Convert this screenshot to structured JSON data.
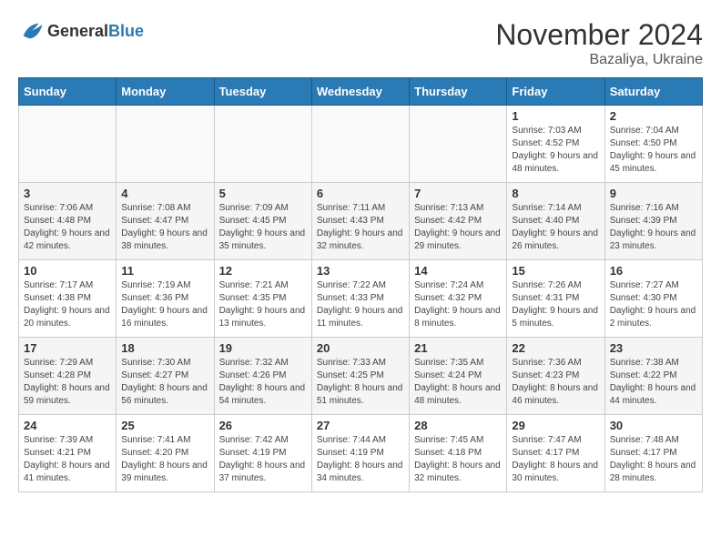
{
  "logo": {
    "general": "General",
    "blue": "Blue"
  },
  "title": {
    "month": "November 2024",
    "location": "Bazaliya, Ukraine"
  },
  "weekdays": [
    "Sunday",
    "Monday",
    "Tuesday",
    "Wednesday",
    "Thursday",
    "Friday",
    "Saturday"
  ],
  "weeks": [
    [
      {
        "day": "",
        "info": ""
      },
      {
        "day": "",
        "info": ""
      },
      {
        "day": "",
        "info": ""
      },
      {
        "day": "",
        "info": ""
      },
      {
        "day": "",
        "info": ""
      },
      {
        "day": "1",
        "info": "Sunrise: 7:03 AM\nSunset: 4:52 PM\nDaylight: 9 hours and 48 minutes."
      },
      {
        "day": "2",
        "info": "Sunrise: 7:04 AM\nSunset: 4:50 PM\nDaylight: 9 hours and 45 minutes."
      }
    ],
    [
      {
        "day": "3",
        "info": "Sunrise: 7:06 AM\nSunset: 4:48 PM\nDaylight: 9 hours and 42 minutes."
      },
      {
        "day": "4",
        "info": "Sunrise: 7:08 AM\nSunset: 4:47 PM\nDaylight: 9 hours and 38 minutes."
      },
      {
        "day": "5",
        "info": "Sunrise: 7:09 AM\nSunset: 4:45 PM\nDaylight: 9 hours and 35 minutes."
      },
      {
        "day": "6",
        "info": "Sunrise: 7:11 AM\nSunset: 4:43 PM\nDaylight: 9 hours and 32 minutes."
      },
      {
        "day": "7",
        "info": "Sunrise: 7:13 AM\nSunset: 4:42 PM\nDaylight: 9 hours and 29 minutes."
      },
      {
        "day": "8",
        "info": "Sunrise: 7:14 AM\nSunset: 4:40 PM\nDaylight: 9 hours and 26 minutes."
      },
      {
        "day": "9",
        "info": "Sunrise: 7:16 AM\nSunset: 4:39 PM\nDaylight: 9 hours and 23 minutes."
      }
    ],
    [
      {
        "day": "10",
        "info": "Sunrise: 7:17 AM\nSunset: 4:38 PM\nDaylight: 9 hours and 20 minutes."
      },
      {
        "day": "11",
        "info": "Sunrise: 7:19 AM\nSunset: 4:36 PM\nDaylight: 9 hours and 16 minutes."
      },
      {
        "day": "12",
        "info": "Sunrise: 7:21 AM\nSunset: 4:35 PM\nDaylight: 9 hours and 13 minutes."
      },
      {
        "day": "13",
        "info": "Sunrise: 7:22 AM\nSunset: 4:33 PM\nDaylight: 9 hours and 11 minutes."
      },
      {
        "day": "14",
        "info": "Sunrise: 7:24 AM\nSunset: 4:32 PM\nDaylight: 9 hours and 8 minutes."
      },
      {
        "day": "15",
        "info": "Sunrise: 7:26 AM\nSunset: 4:31 PM\nDaylight: 9 hours and 5 minutes."
      },
      {
        "day": "16",
        "info": "Sunrise: 7:27 AM\nSunset: 4:30 PM\nDaylight: 9 hours and 2 minutes."
      }
    ],
    [
      {
        "day": "17",
        "info": "Sunrise: 7:29 AM\nSunset: 4:28 PM\nDaylight: 8 hours and 59 minutes."
      },
      {
        "day": "18",
        "info": "Sunrise: 7:30 AM\nSunset: 4:27 PM\nDaylight: 8 hours and 56 minutes."
      },
      {
        "day": "19",
        "info": "Sunrise: 7:32 AM\nSunset: 4:26 PM\nDaylight: 8 hours and 54 minutes."
      },
      {
        "day": "20",
        "info": "Sunrise: 7:33 AM\nSunset: 4:25 PM\nDaylight: 8 hours and 51 minutes."
      },
      {
        "day": "21",
        "info": "Sunrise: 7:35 AM\nSunset: 4:24 PM\nDaylight: 8 hours and 48 minutes."
      },
      {
        "day": "22",
        "info": "Sunrise: 7:36 AM\nSunset: 4:23 PM\nDaylight: 8 hours and 46 minutes."
      },
      {
        "day": "23",
        "info": "Sunrise: 7:38 AM\nSunset: 4:22 PM\nDaylight: 8 hours and 44 minutes."
      }
    ],
    [
      {
        "day": "24",
        "info": "Sunrise: 7:39 AM\nSunset: 4:21 PM\nDaylight: 8 hours and 41 minutes."
      },
      {
        "day": "25",
        "info": "Sunrise: 7:41 AM\nSunset: 4:20 PM\nDaylight: 8 hours and 39 minutes."
      },
      {
        "day": "26",
        "info": "Sunrise: 7:42 AM\nSunset: 4:19 PM\nDaylight: 8 hours and 37 minutes."
      },
      {
        "day": "27",
        "info": "Sunrise: 7:44 AM\nSunset: 4:19 PM\nDaylight: 8 hours and 34 minutes."
      },
      {
        "day": "28",
        "info": "Sunrise: 7:45 AM\nSunset: 4:18 PM\nDaylight: 8 hours and 32 minutes."
      },
      {
        "day": "29",
        "info": "Sunrise: 7:47 AM\nSunset: 4:17 PM\nDaylight: 8 hours and 30 minutes."
      },
      {
        "day": "30",
        "info": "Sunrise: 7:48 AM\nSunset: 4:17 PM\nDaylight: 8 hours and 28 minutes."
      }
    ]
  ]
}
